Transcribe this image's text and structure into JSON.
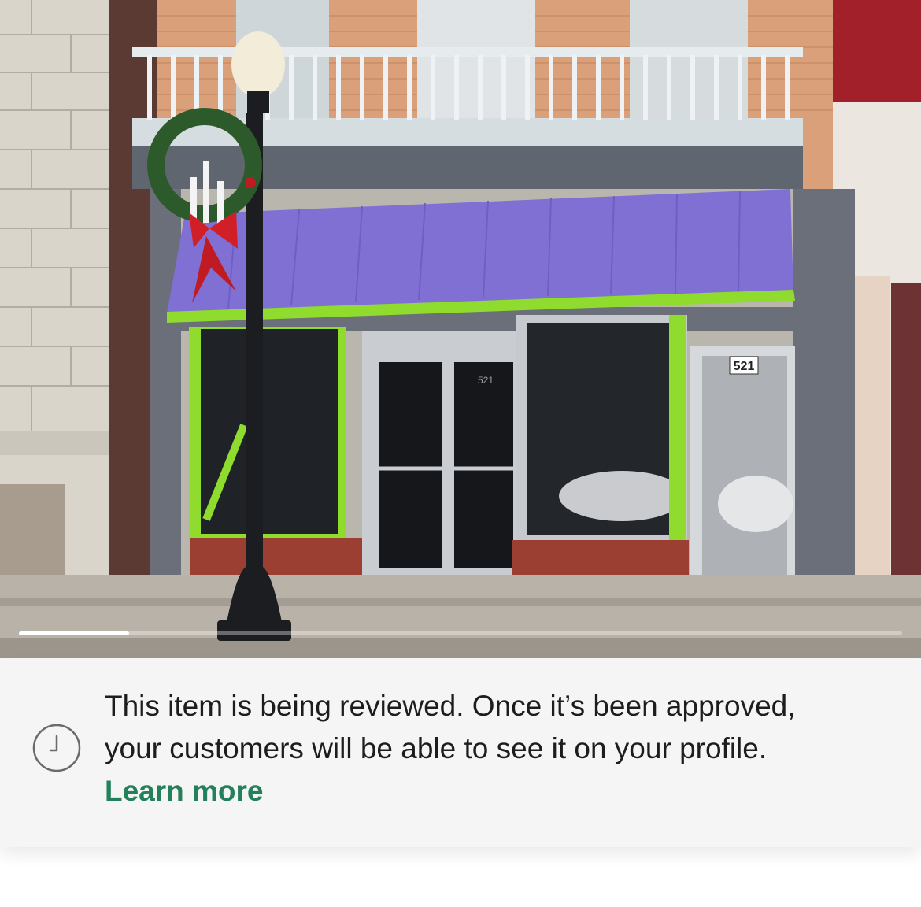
{
  "photo": {
    "alt": "",
    "carousel": {
      "current": 1,
      "progress": 0.125
    },
    "address_sign_text": "521",
    "door_number_text": "521"
  },
  "notice": {
    "icon": "clock-icon",
    "message_line1": "This item is being reviewed. Once it’s been approved,",
    "message_line2": "your customers will be able to see it on your profile.",
    "learn_more_label": "Learn more",
    "link_color": "#24805a"
  },
  "next_section": {
    "heading_partial": ""
  }
}
